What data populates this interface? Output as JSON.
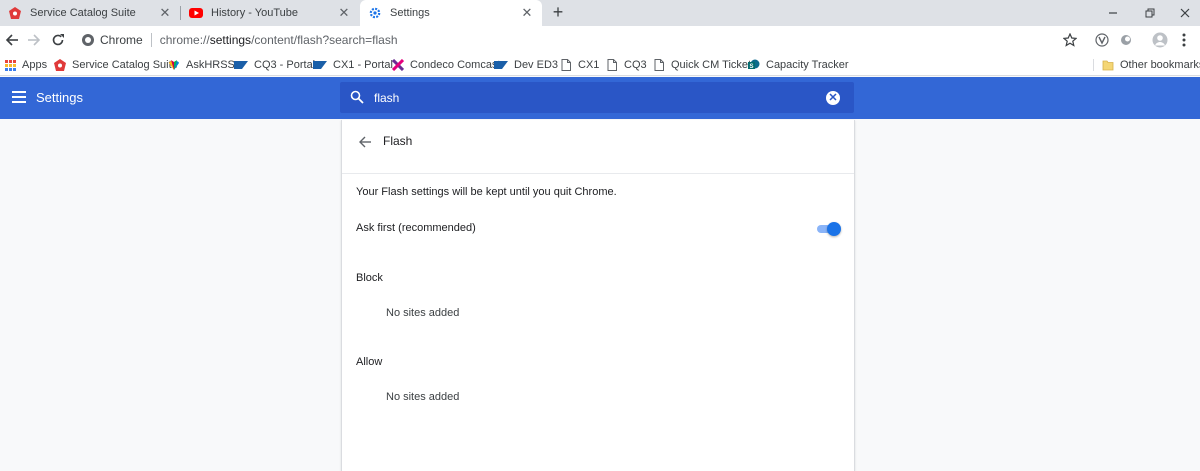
{
  "tabs": [
    {
      "title": "Service Catalog Suite",
      "icon": "service-catalog-icon"
    },
    {
      "title": "History - YouTube",
      "icon": "youtube-icon"
    },
    {
      "title": "Settings",
      "icon": "gear-icon",
      "active": true
    }
  ],
  "omnibox": {
    "chip_label": "Chrome",
    "url_prefix": "chrome://",
    "url_host": "settings",
    "url_rest": "/content/flash?search=flash"
  },
  "bookmarks": [
    {
      "label": "Apps",
      "icon": "apps-grid-icon"
    },
    {
      "label": "Service Catalog Suite",
      "icon": "service-catalog-icon"
    },
    {
      "label": "AskHRSS",
      "icon": "peacock-icon"
    },
    {
      "label": "CQ3 - Portal",
      "icon": "sap-icon"
    },
    {
      "label": "CX1 - Portal",
      "icon": "sap-icon"
    },
    {
      "label": "Condeco Comcast",
      "icon": "condeco-icon"
    },
    {
      "label": "Dev ED3",
      "icon": "sap-icon"
    },
    {
      "label": "CX1",
      "icon": "page-icon"
    },
    {
      "label": "CQ3",
      "icon": "page-icon"
    },
    {
      "label": "Quick CM Ticket",
      "icon": "page-icon"
    },
    {
      "label": "Capacity Tracker",
      "icon": "sharepoint-icon"
    },
    {
      "label": "Other bookmarks",
      "icon": "folder-icon"
    }
  ],
  "header": {
    "title": "Settings",
    "search_value": "flash"
  },
  "page": {
    "title": "Flash",
    "note": "Your Flash settings will be kept until you quit Chrome.",
    "ask_first_label": "Ask first (recommended)",
    "ask_first_on": true,
    "block_title": "Block",
    "block_empty": "No sites added",
    "allow_title": "Allow",
    "allow_empty": "No sites added"
  },
  "colors": {
    "header_blue": "#3367d6",
    "search_blue": "#2a56c6",
    "toggle_on": "#1a73e8"
  }
}
